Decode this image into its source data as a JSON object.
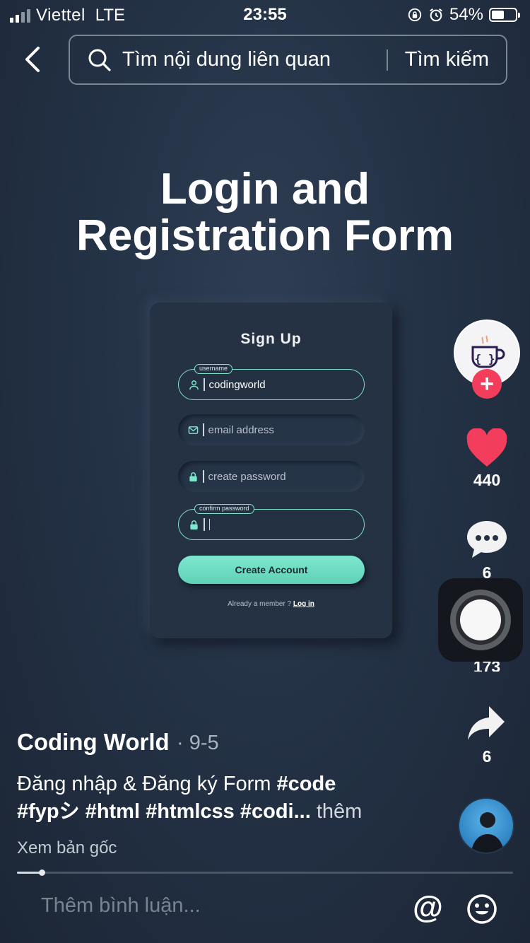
{
  "status_bar": {
    "carrier": "Viettel",
    "network": "LTE",
    "time": "23:55",
    "battery_percent": "54%",
    "battery_level": 0.54
  },
  "search": {
    "placeholder": "Tìm nội dung liên quan",
    "button_label": "Tìm kiếm"
  },
  "video": {
    "title_line1": "Login and",
    "title_line2": "Registration Form",
    "form": {
      "heading": "Sign Up",
      "username_tag": "username",
      "username_value": "codingworld",
      "email_placeholder": "email address",
      "password_placeholder": "create password",
      "confirm_tag": "confirm password",
      "create_button": "Create Account",
      "member_text": "Already a member ?",
      "login_link": "Log in"
    },
    "accent_color": "#7ee8cf"
  },
  "rail": {
    "likes": "440",
    "comments": "6",
    "bookmarks": "173",
    "shares": "6",
    "like_color": "#f23e5c"
  },
  "post": {
    "author": "Coding World",
    "date": "· 9-5",
    "desc_text": "Đăng nhập & Đăng ký Form ",
    "tags_line1": "#code",
    "tags_line2": "#fypシ #html #htmlcss #codi...",
    "more": " thêm",
    "view_original": "Xem bản gốc",
    "progress": 0.05
  },
  "comment_bar": {
    "placeholder": "Thêm bình luận..."
  }
}
